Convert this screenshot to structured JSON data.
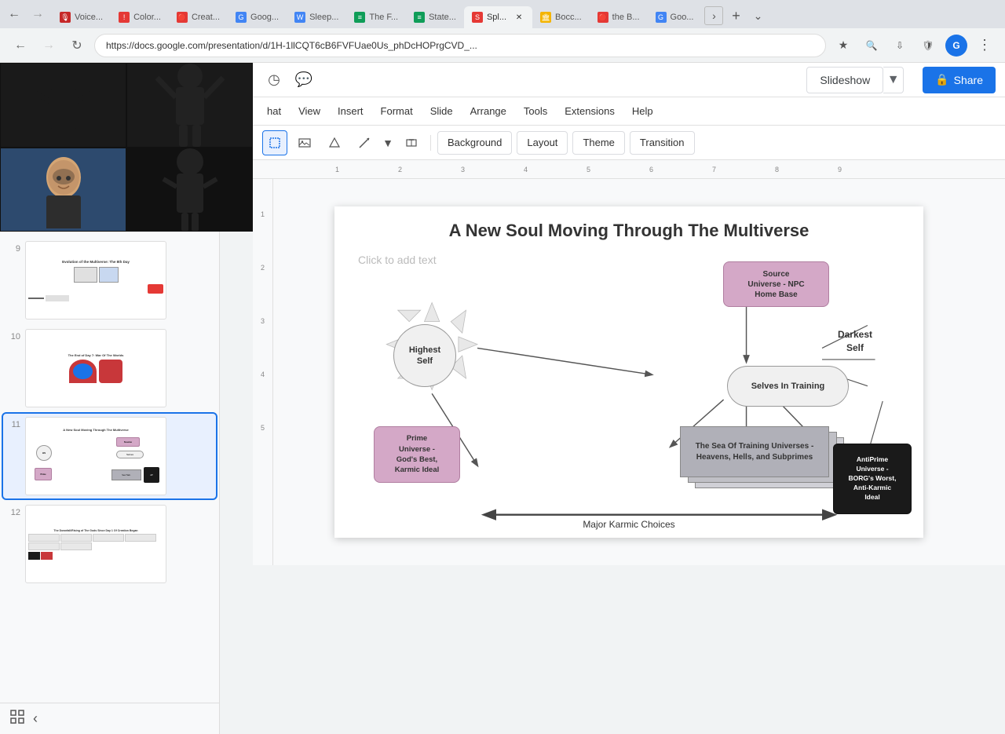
{
  "browser": {
    "url": "https://docs.google.com/presentation/d/1H-1llCQT6cB6FVFUae0Us_phDcHOPrgCVD_...",
    "tabs": [
      {
        "label": "Creat...",
        "favicon_color": "#e53935",
        "active": false,
        "icon": "🔴"
      },
      {
        "label": "Goog...",
        "favicon_color": "#fbbc04",
        "active": false,
        "icon": "G"
      },
      {
        "label": "Sleep...",
        "favicon_color": "#4285f4",
        "active": false,
        "icon": "W"
      },
      {
        "label": "The F...",
        "favicon_color": "#0f9d58",
        "active": false,
        "icon": "≡"
      },
      {
        "label": "State...",
        "favicon_color": "#0f9d58",
        "active": false,
        "icon": "≡"
      },
      {
        "label": "Spl...",
        "favicon_color": "#e53935",
        "active": true,
        "icon": "S"
      },
      {
        "label": "Bocc...",
        "favicon_color": "#f4b400",
        "active": false,
        "icon": "🏛"
      },
      {
        "label": "the B...",
        "favicon_color": "#e53935",
        "active": false,
        "icon": "🔴"
      },
      {
        "label": "Goo...",
        "favicon_color": "#fbbc04",
        "active": false,
        "icon": "G"
      }
    ]
  },
  "menu": {
    "items": [
      "hat",
      "View",
      "Insert",
      "Format",
      "Slide",
      "Arrange",
      "Tools",
      "Extensions",
      "Help"
    ]
  },
  "toolbar": {
    "background_label": "Background",
    "layout_label": "Layout",
    "theme_label": "Theme",
    "transition_label": "Transition",
    "slideshow_label": "Slideshow",
    "share_label": "Share"
  },
  "slide_panel": {
    "slides": [
      {
        "num": 9,
        "title": "Evolution of the Multiverse: The 8th Day",
        "preview_bg": "#fff"
      },
      {
        "num": 10,
        "title": "The End of Day 7: War Of The Worlds",
        "preview_bg": "#fff"
      },
      {
        "num": 11,
        "title": "A New Soul Moving Through The Multiverse",
        "preview_bg": "#fff",
        "selected": true
      },
      {
        "num": 12,
        "title": "The Downfall/Rising of The Gods Since Day 1 Of Creation Began",
        "preview_bg": "#fff"
      }
    ]
  },
  "slide11": {
    "title": "A New Soul Moving Through The Multiverse",
    "placeholder": "Click to add text",
    "highest_self": "Highest\nSelf",
    "source_universe": "Source\nUniverse - NPC\nHome Base",
    "selves_training": "Selves In Training",
    "prime_universe": "Prime\nUniverse -\nGod's Best,\nKarmic Ideal",
    "sea_training": "The Sea Of Training Universes -\nHeavens, Hells, and Subprimes",
    "antiprime": "AntiPrime\nUniverse -\nBORG's Worst,\nAnti-Karmic\nIdeal",
    "darkest_self": "Darkest\nSelf",
    "arrow_label": "Major Karmic Choices"
  }
}
